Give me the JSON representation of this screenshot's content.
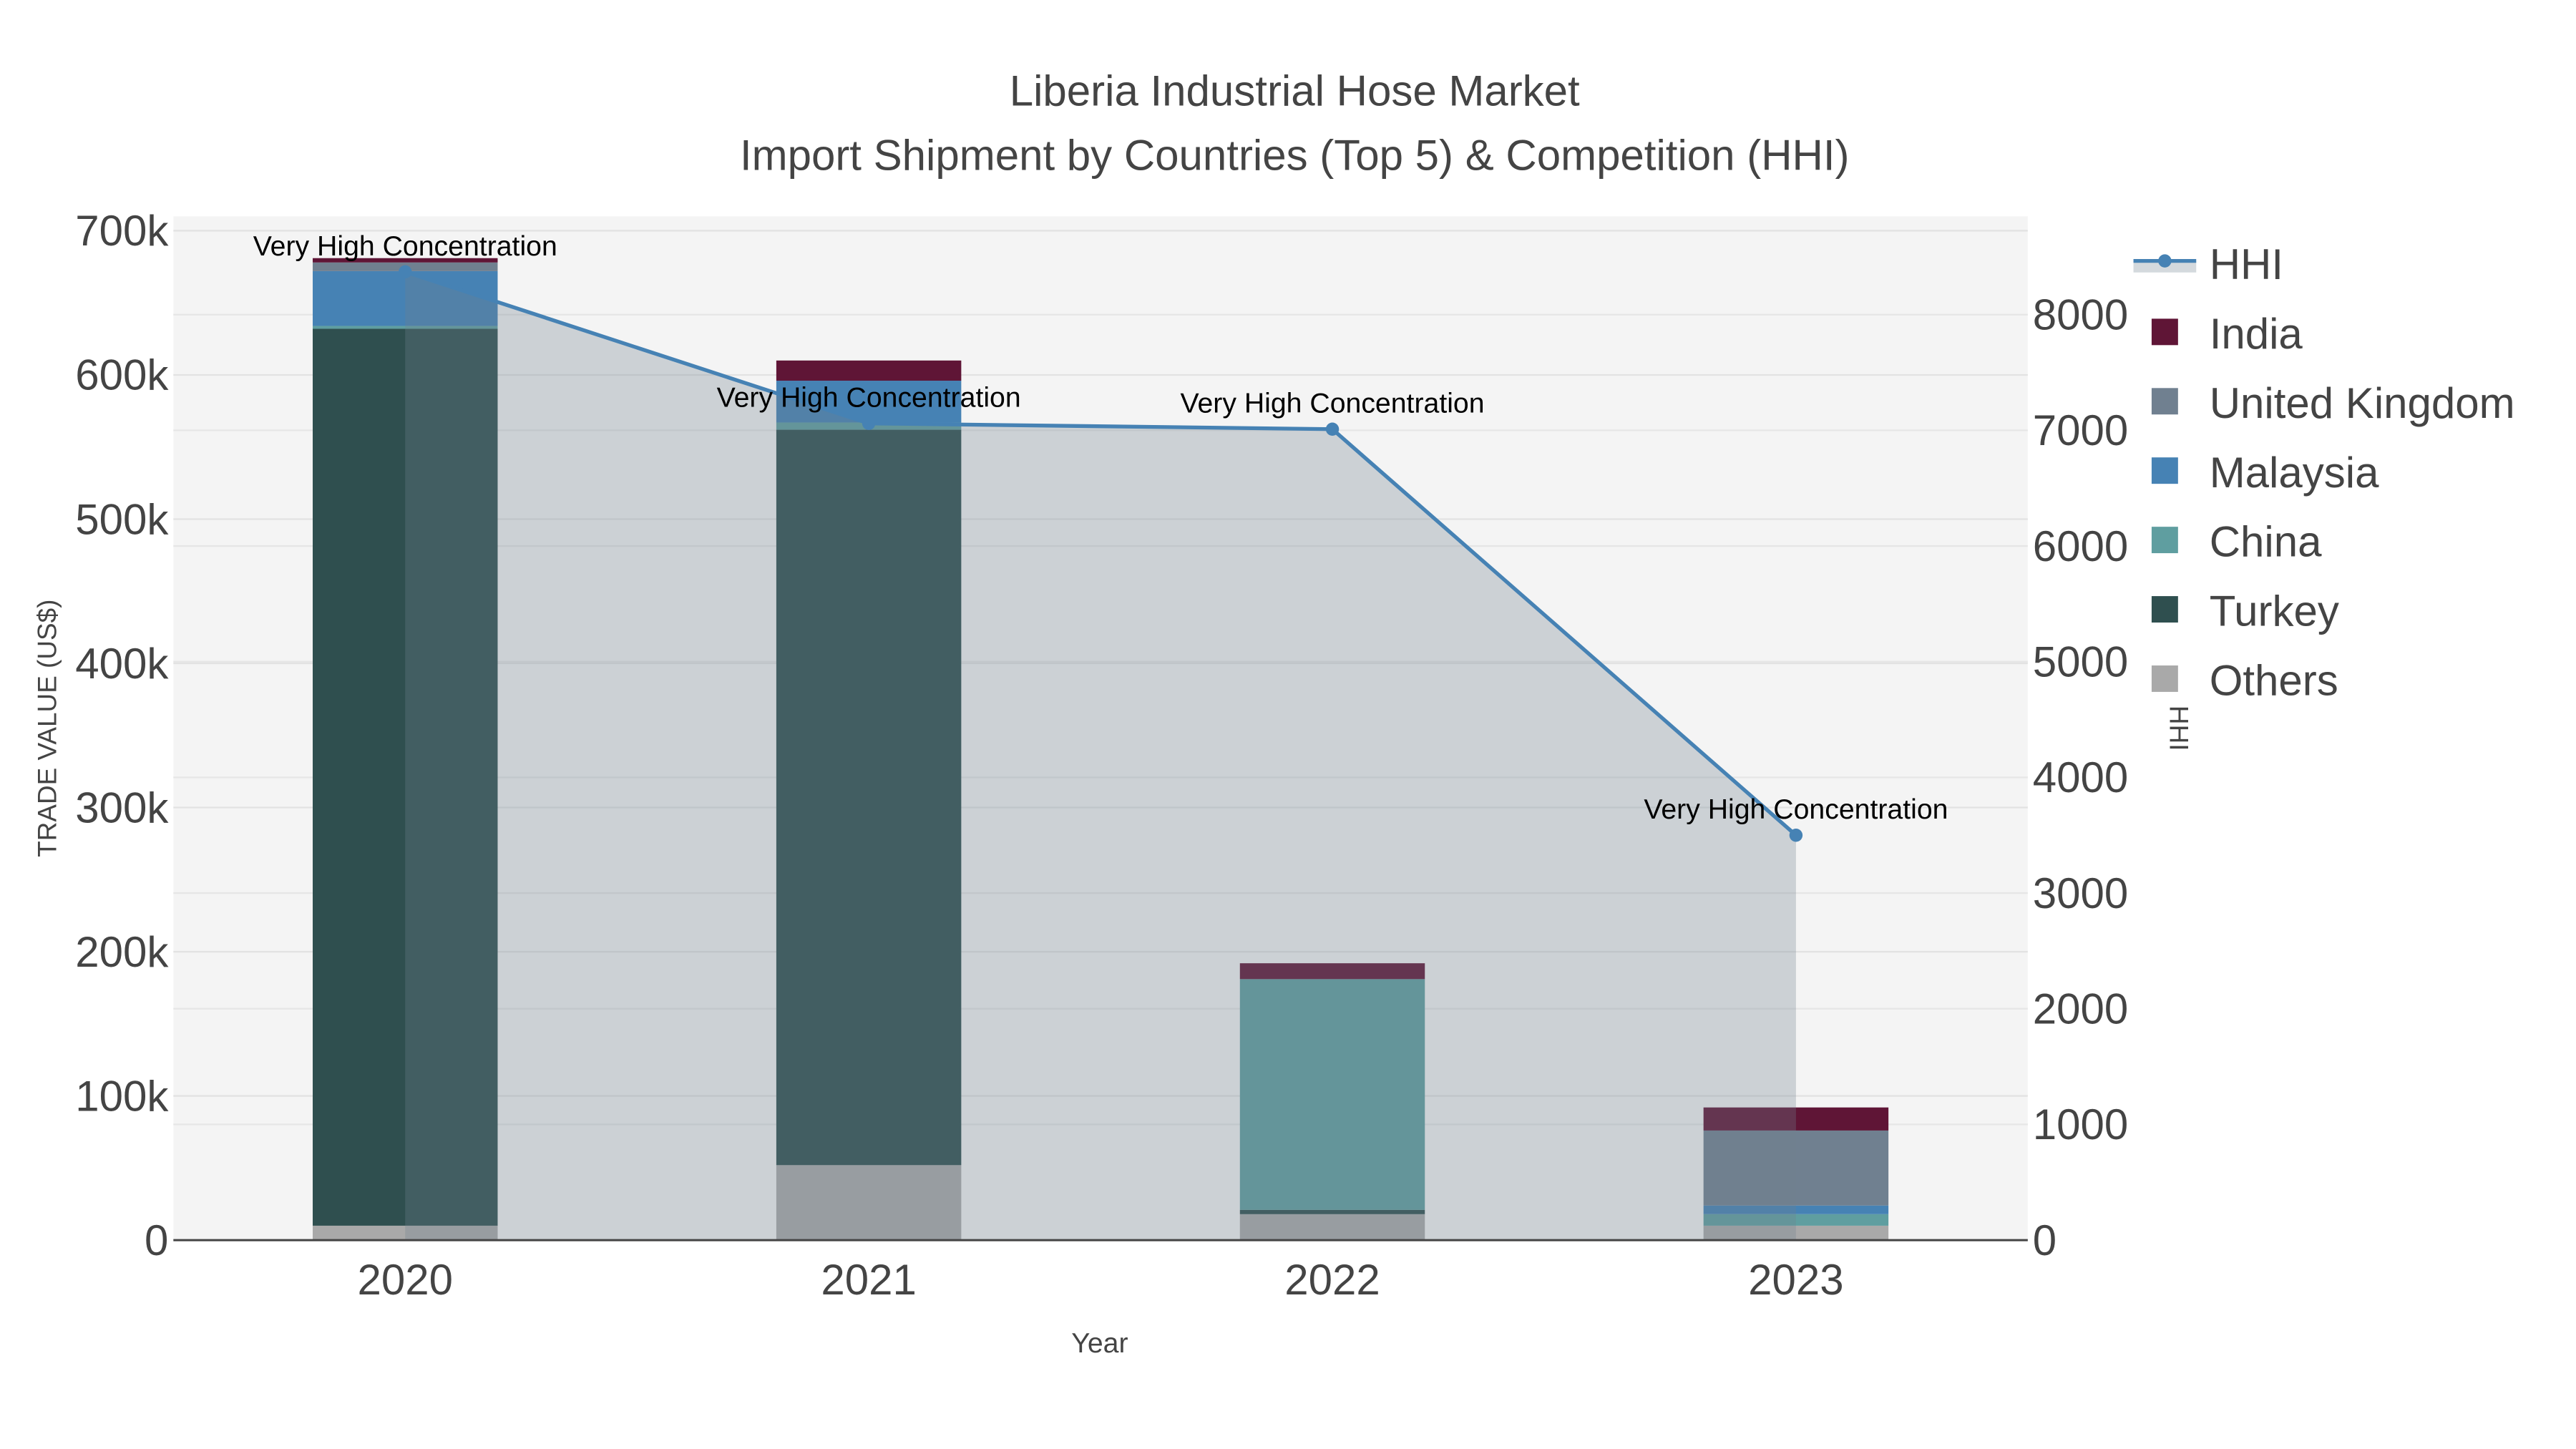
{
  "chart_data": {
    "type": "bar",
    "title": "Liberia Industrial Hose Market",
    "subtitle": "Import Shipment by Countries (Top 5) & Competition (HHI)",
    "xlabel": "Year",
    "ylabel": "TRADE VALUE (US$)",
    "y2label": "HHI",
    "categories": [
      "2020",
      "2021",
      "2022",
      "2023"
    ],
    "ylim": [
      0,
      710000
    ],
    "y2lim": [
      0,
      8850
    ],
    "yticks": [
      0,
      100000,
      200000,
      300000,
      400000,
      500000,
      600000,
      700000
    ],
    "ytick_labels": [
      "0",
      "100k",
      "200k",
      "300k",
      "400k",
      "500k",
      "600k",
      "700k"
    ],
    "y2ticks": [
      0,
      1000,
      2000,
      3000,
      4000,
      5000,
      6000,
      7000,
      8000
    ],
    "y2tick_labels": [
      "0",
      "1000",
      "2000",
      "3000",
      "4000",
      "5000",
      "6000",
      "7000",
      "8000"
    ],
    "grid": true,
    "legend_position": "right",
    "series": [
      {
        "name": "Others",
        "color": "#a9a9a9",
        "values": [
          10000,
          52000,
          18000,
          10000
        ]
      },
      {
        "name": "Turkey",
        "color": "#2f4f4f",
        "values": [
          622000,
          510000,
          3000,
          0
        ]
      },
      {
        "name": "China",
        "color": "#5f9ea0",
        "values": [
          2000,
          5000,
          160000,
          8000
        ]
      },
      {
        "name": "Malaysia",
        "color": "#4682b4",
        "values": [
          38000,
          29000,
          0,
          6000
        ]
      },
      {
        "name": "United Kingdom",
        "color": "#708090",
        "values": [
          6000,
          0,
          0,
          52000
        ]
      },
      {
        "name": "India",
        "color": "#5f1536",
        "values": [
          3000,
          14000,
          11000,
          16000
        ]
      }
    ],
    "hhi": {
      "name": "HHI",
      "color": "#4682b4",
      "values": [
        8370,
        7060,
        7010,
        3500
      ]
    },
    "annotations": [
      "Very High Concentration",
      "Very High Concentration",
      "Very High Concentration",
      "Very High Concentration"
    ],
    "legend_order": [
      "HHI",
      "India",
      "United Kingdom",
      "Malaysia",
      "China",
      "Turkey",
      "Others"
    ]
  }
}
